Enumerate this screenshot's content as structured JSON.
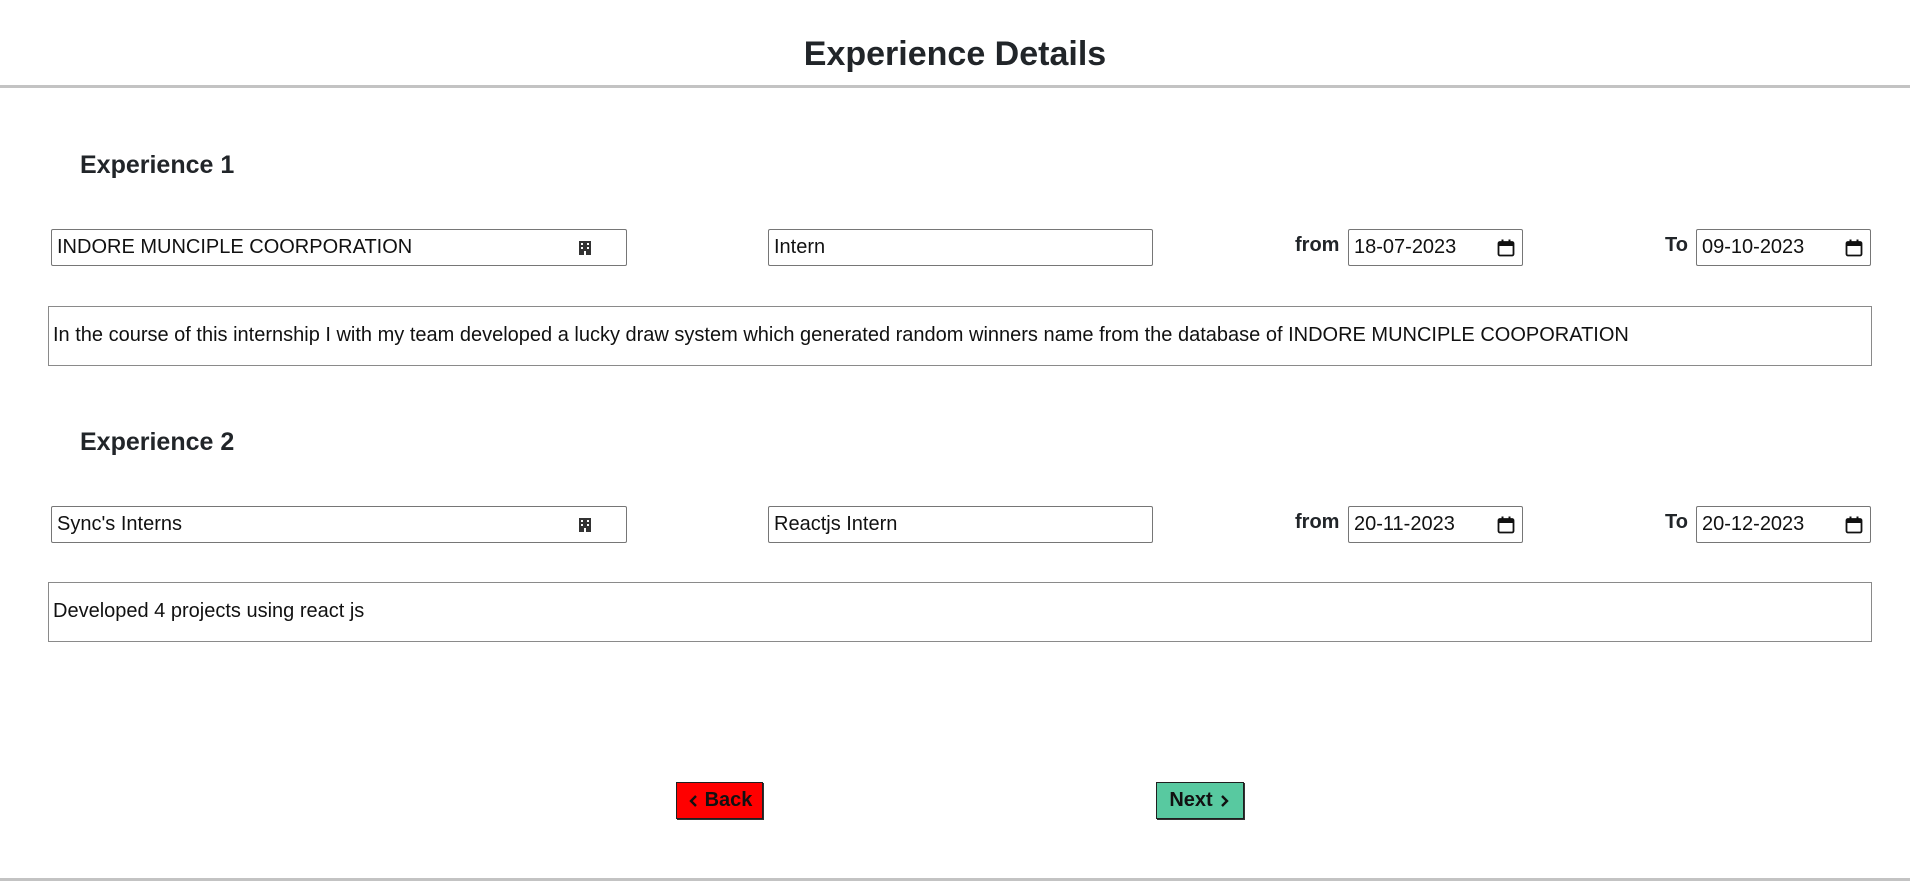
{
  "page": {
    "title": "Experience Details"
  },
  "experiences": [
    {
      "heading": "Experience 1",
      "company": "INDORE MUNCIPLE COORPORATION",
      "role": "Intern",
      "from_label": "from",
      "from_date": "18-07-2023",
      "to_label": "To",
      "to_date": "09-10-2023",
      "description": "In the course of this internship I with my team developed a lucky draw system which generated random winners name from the database of INDORE MUNCIPLE COOPORATION"
    },
    {
      "heading": "Experience 2",
      "company": "Sync's Interns",
      "role": "Reactjs Intern",
      "from_label": "from",
      "from_date": "20-11-2023",
      "to_label": "To",
      "to_date": "20-12-2023",
      "description": "Developed 4 projects using react js"
    }
  ],
  "buttons": {
    "back": "Back",
    "next": "Next"
  },
  "icons": {
    "company_field": "building-icon",
    "date_field": "calendar-icon",
    "back": "chevron-left-icon",
    "next": "chevron-right-icon"
  },
  "colors": {
    "back_button": "#ff0000",
    "next_button": "#58c9a0"
  }
}
